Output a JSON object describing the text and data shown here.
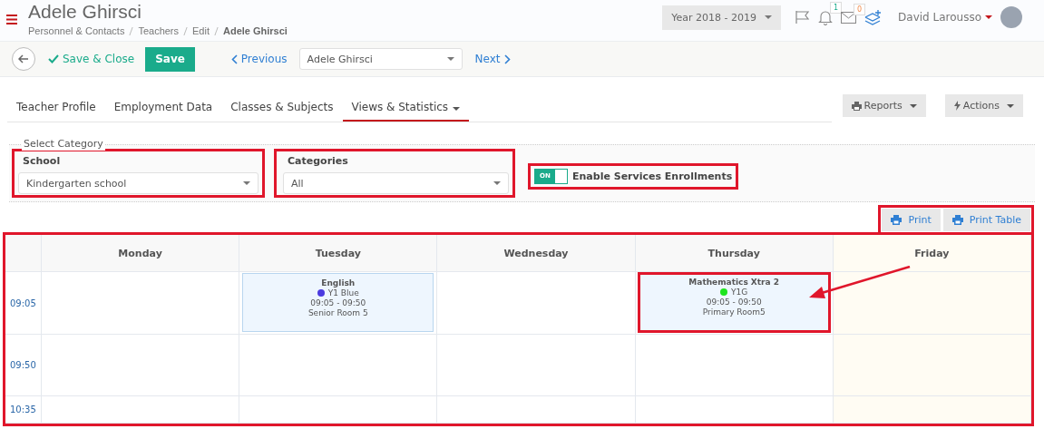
{
  "header": {
    "title": "Adele Ghirsci",
    "breadcrumbs": [
      {
        "label": "Personnel & Contacts",
        "current": false
      },
      {
        "label": "Teachers",
        "current": false
      },
      {
        "label": "Edit",
        "current": false
      },
      {
        "label": "Adele Ghirsci",
        "current": true
      }
    ],
    "year": "Year 2018 - 2019",
    "notifications": "1",
    "messages": "0",
    "user": "David Larousso"
  },
  "toolbar": {
    "save_close": "Save & Close",
    "save": "Save",
    "previous": "Previous",
    "teacher": "Adele Ghirsci",
    "next": "Next"
  },
  "tabs": [
    {
      "label": "Teacher Profile",
      "selected": false,
      "dropdown": false
    },
    {
      "label": "Employment Data",
      "selected": false,
      "dropdown": false
    },
    {
      "label": "Classes & Subjects",
      "selected": false,
      "dropdown": false
    },
    {
      "label": "Views & Statistics",
      "selected": true,
      "dropdown": true
    }
  ],
  "tab_actions": [
    "Reports",
    "Actions"
  ],
  "category": {
    "legend": "Select Category",
    "filters": [
      {
        "label": "School",
        "value": "Kindergarten school",
        "annotated": true
      },
      {
        "label": "Categories",
        "value": "All",
        "annotated": true
      }
    ],
    "toggle": {
      "on": true,
      "state_text": "ON",
      "label": "Enable Services Enrollments",
      "annotated": true
    }
  },
  "print_buttons": {
    "annotated": true,
    "items": [
      "Print",
      "Print Table"
    ]
  },
  "timetable": {
    "annotated": true,
    "days": [
      {
        "name": "Monday",
        "today": false
      },
      {
        "name": "Tuesday",
        "today": false
      },
      {
        "name": "Wednesday",
        "today": false
      },
      {
        "name": "Thursday",
        "today": false
      },
      {
        "name": "Friday",
        "today": true
      }
    ],
    "rows": [
      {
        "time": "09:05",
        "cells": [
          {
            "kind": "empty"
          },
          {
            "kind": "event",
            "subject": "English",
            "group": "Y1 Blue",
            "color": "#4b3be0",
            "hours": "09:05 - 09:50",
            "room": "Senior Room 5",
            "annotated": false
          },
          {
            "kind": "empty"
          },
          {
            "kind": "event",
            "subject": "Mathematics Xtra 2",
            "group": "Y1G",
            "color": "#1ee51e",
            "hours": "09:05 - 09:50",
            "room": "Primary Room5",
            "annotated": true
          },
          {
            "kind": "empty"
          }
        ]
      },
      {
        "time": "09:50",
        "cells": [
          {
            "kind": "empty"
          },
          {
            "kind": "empty"
          },
          {
            "kind": "empty"
          },
          {
            "kind": "empty"
          },
          {
            "kind": "empty"
          }
        ]
      },
      {
        "time": "10:35",
        "cells": [
          {
            "kind": "empty"
          },
          {
            "kind": "empty"
          },
          {
            "kind": "empty"
          },
          {
            "kind": "empty"
          },
          {
            "kind": "empty"
          }
        ]
      }
    ]
  }
}
